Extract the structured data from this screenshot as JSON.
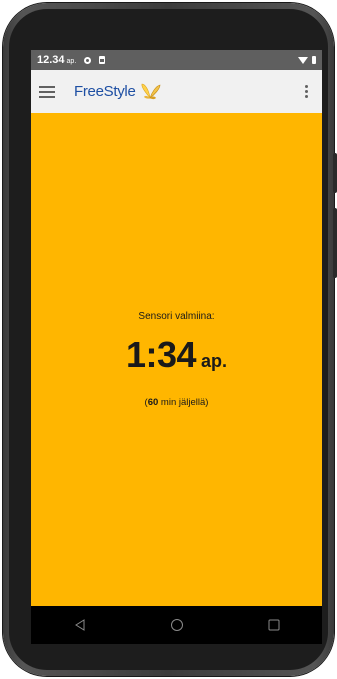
{
  "status_bar": {
    "time": "12.34",
    "time_suffix": "ap.",
    "icons": [
      "notification-dot-icon",
      "sim-card-icon",
      "wifi-icon",
      "battery-icon"
    ]
  },
  "app_bar": {
    "brand": "FreeStyle",
    "menu_icon": "hamburger-menu-icon",
    "logo_icon": "butterfly-logo-icon",
    "overflow_icon": "more-vertical-icon"
  },
  "sensor": {
    "ready_label": "Sensori valmiina:",
    "time": "1:34",
    "time_suffix": "ap.",
    "remaining_open": "(",
    "remaining_minutes": "60",
    "remaining_text": " min jäljellä)"
  },
  "nav_bar": {
    "icons": [
      "back-icon",
      "home-icon",
      "recent-apps-icon"
    ]
  },
  "colors": {
    "background": "#ffb600",
    "brand": "#1e4fa3",
    "status_bar": "#5f5f5f",
    "app_bar": "#f1f1f1"
  }
}
